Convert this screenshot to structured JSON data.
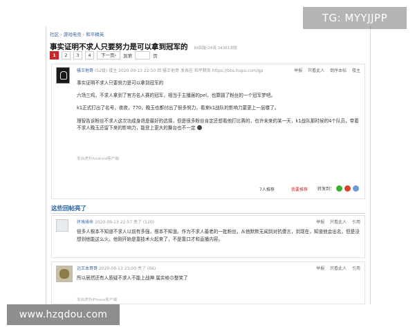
{
  "overlay": {
    "tg_label": "TG: MYYJJPP"
  },
  "watermark": {
    "text": "www.hzqdou.com"
  },
  "breadcrumb": {
    "items": [
      "社区",
      "游戏电竞",
      "和平精英"
    ],
    "sep": "›"
  },
  "thread": {
    "title": "事实证明不求人只要努力是可以拿到冠军的",
    "meta": "69回复/26亮 34361浏览"
  },
  "pager": {
    "pages": [
      "1",
      "2",
      "3",
      "4"
    ],
    "current": "1",
    "next_label": "下一页›",
    "jump_label": "到第",
    "page_suffix": "页"
  },
  "main_post": {
    "username": "骚王他哥",
    "level": "(52级)",
    "tag": "楼主",
    "timestamp": "2020-09-13 22:50",
    "header_extra": "回 骚王他哥 发表在 和平精英 https://bbs.hupu.com/gp",
    "actions": [
      "举报",
      "只看此人",
      "倒序本帖",
      "楼主"
    ],
    "paragraphs": [
      "事实证明不求人只要努力是可以拿到冠军的",
      "六场三鸡，不求人拿到了官方名人赛的冠军，相当于主播届的pel，也算圆了粉丝的一个冠军梦吧。",
      "k1正式打出了名号，夜夜，770，晚玉也都付出了很多努力，看来k1战队的影响力要更上一层楼了。",
      "理智告诉粉丝不求人这次功成身退是最好的选择，但是很多粉丝肯定还想看他打比赛的，也许未来的某一天，k1战队那时候的4个队员，带着不求人晚玉还留下来的影响力，能登上更大的舞台也不一定"
    ],
    "source": "发自虎扑Android客户端",
    "recommend": "7人推荐",
    "recommend_action": "我要推荐",
    "share_label": "转发到："
  },
  "hot_section": {
    "title": "这些回帖亮了"
  },
  "replies": [
    {
      "username": "环境排命",
      "timestamp": "2020-09-13 22:57",
      "light": "亮了 (120)",
      "actions": [
        "举报",
        "只看此人",
        "引用"
      ],
      "text": "很多人根本不知道不求人以前有多强，根本不知道。作为不求人最老的一批粉丝，从他默默无闻到对抗傻言，到现在，知道他会出名，但是没想到他能这么火。他刚开始是靠技术火起来了，不是靠口才和直播内容。"
    },
    {
      "username": "远王本哥哥",
      "timestamp": "2020-09-13 23:00",
      "light": "亮了 (66)",
      "actions": [
        "举报",
        "只看此人",
        "引用"
      ],
      "text": "所以居然还有人质疑不求人不能上战神 属实格🙃整笑了",
      "source": "发自虎扑iPhone客户端"
    }
  ],
  "colors": {
    "accent_red": "#c62828",
    "link_blue": "#3a63a0",
    "section_blue": "#1f5fa8"
  }
}
